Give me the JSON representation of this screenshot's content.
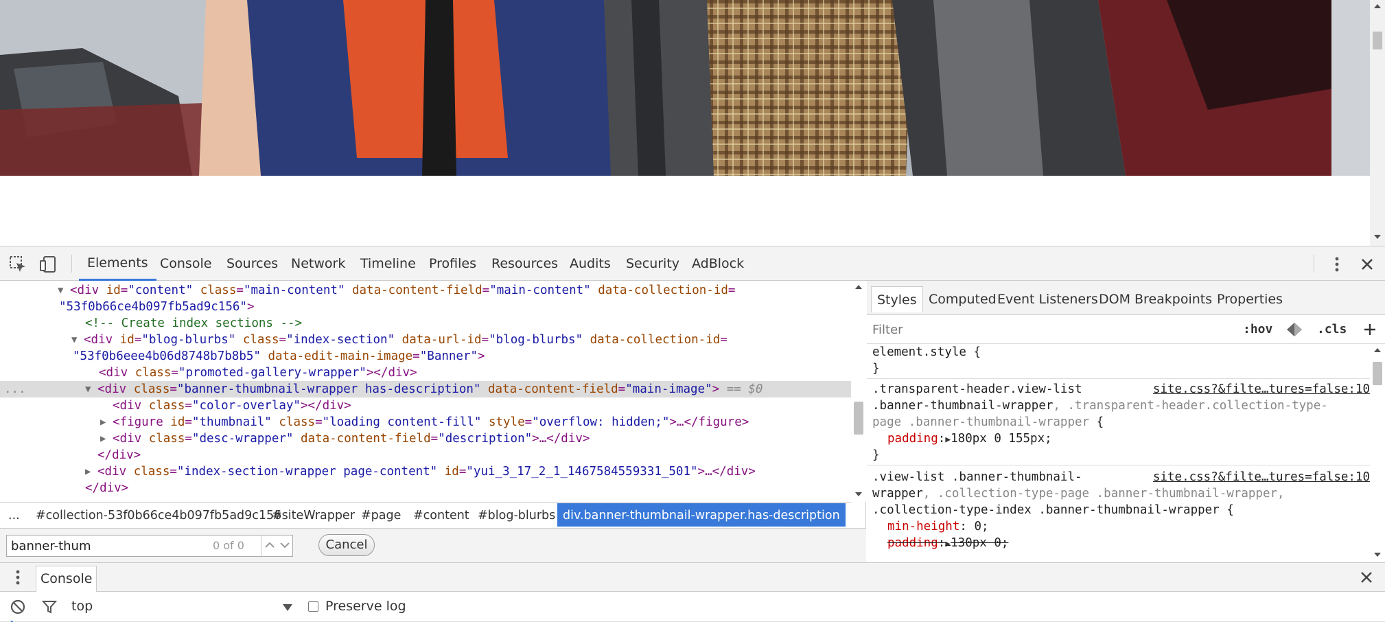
{
  "devtools": {
    "tabs": [
      "Elements",
      "Console",
      "Sources",
      "Network",
      "Timeline",
      "Profiles",
      "Resources",
      "Audits",
      "Security",
      "AdBlock"
    ],
    "active_tab": "Elements"
  },
  "dom": {
    "l1": {
      "tag_open": "<div ",
      "a1": "id",
      "v1": "\"content\"",
      "a2": "class",
      "v2": "\"main-content\"",
      "a3": "data-content-field",
      "v3": "\"main-content\"",
      "a4": "data-collection-id",
      "eq": "="
    },
    "l2": {
      "v": "\"53f0b66ce4b097fb5ad9c156\"",
      "close": ">"
    },
    "l3": {
      "comment": "<!-- Create index sections -->"
    },
    "l4": {
      "tag_open": "<div ",
      "a1": "id",
      "v1": "\"blog-blurbs\"",
      "a2": "class",
      "v2": "\"index-section\"",
      "a3": "data-url-id",
      "v3": "\"blog-blurbs\"",
      "a4": "data-collection-id",
      "eq": "="
    },
    "l5": {
      "v": "\"53f0b6eee4b06d8748b7b8b5\"",
      "a1": "data-edit-main-image",
      "v1": "\"Banner\"",
      "close": ">"
    },
    "l6": {
      "tag_open": "<div ",
      "a1": "class",
      "v1": "\"promoted-gallery-wrapper\"",
      "tag_close": "></div>"
    },
    "l7": {
      "tag_open": "<div ",
      "a1": "class",
      "v1": "\"banner-thumbnail-wrapper has-description\"",
      "a2": "data-content-field",
      "v2": "\"main-image\"",
      "close": ">",
      "eq0": " == $0",
      "dots": "..."
    },
    "l8": {
      "tag_open": "<div ",
      "a1": "class",
      "v1": "\"color-overlay\"",
      "tag_close": "></div>"
    },
    "l9": {
      "tag_open": "<figure ",
      "a1": "id",
      "v1": "\"thumbnail\"",
      "a2": "class",
      "v2": "\"loading content-fill\"",
      "a3": "style",
      "v3": "\"overflow: hidden;\"",
      "mid": ">…",
      "tag_close": "</figure>"
    },
    "l10": {
      "tag_open": "<div ",
      "a1": "class",
      "v1": "\"desc-wrapper\"",
      "a2": "data-content-field",
      "v2": "\"description\"",
      "mid": ">…",
      "tag_close": "</div>"
    },
    "l11": {
      "tag": "</div>"
    },
    "l12": {
      "tag_open": "<div ",
      "a1": "class",
      "v1": "\"index-section-wrapper page-content\"",
      "a2": "id",
      "v2": "\"yui_3_17_2_1_1467584559331_501\"",
      "mid": ">…",
      "tag_close": "</div>"
    },
    "l13": {
      "tag": "</div>"
    }
  },
  "breadcrumbs": [
    "...",
    "#collection-53f0b66ce4b097fb5ad9c156",
    "#siteWrapper",
    "#page",
    "#content",
    "#blog-blurbs",
    "div.banner-thumbnail-wrapper.has-description"
  ],
  "search": {
    "value": "banner-thum",
    "count": "0 of 0",
    "cancel_label": "Cancel"
  },
  "sidebar": {
    "tabs": [
      "Styles",
      "Computed",
      "Event Listeners",
      "DOM Breakpoints",
      "Properties"
    ],
    "active_tab": "Styles",
    "filter_placeholder": "Filter",
    "hov_label": ":hov",
    "cls_label": ".cls",
    "rules": {
      "r0_sel": "element.style {",
      "r0_end": "}",
      "r1_sel_a": ".transparent-header.view-list",
      "r1_src": "site.css?&filte…tures=false:10",
      "r1_sel_b": ".banner-thumbnail-wrapper",
      "r1_sel_c": ", .transparent-header.collection-type-",
      "r1_sel_d": "page .banner-thumbnail-wrapper",
      "r1_sel_e": " {",
      "r1_prop": "padding",
      "r1_val": "180px 0 155px;",
      "r1_end": "}",
      "r2_sel_a": ".view-list .banner-thumbnail-",
      "r2_src": "site.css?&filte…tures=false:10",
      "r2_sel_b": "wrapper",
      "r2_sel_c": ", .collection-type-page .banner-thumbnail-wrapper,",
      "r2_sel_d": ".collection-type-index .banner-thumbnail-wrapper {",
      "r2_prop1": "min-height",
      "r2_val1": "0;",
      "r2_prop2": "padding",
      "r2_val2": "130px 0;"
    }
  },
  "drawer": {
    "tab_label": "Console",
    "context": "top",
    "preserve_label": "Preserve log"
  },
  "colors": {
    "accent": "#3879d9",
    "tag": "#881280",
    "attr": "#994500",
    "value": "#1a1aa6",
    "comment": "#236e25",
    "prop": "#c80000"
  }
}
